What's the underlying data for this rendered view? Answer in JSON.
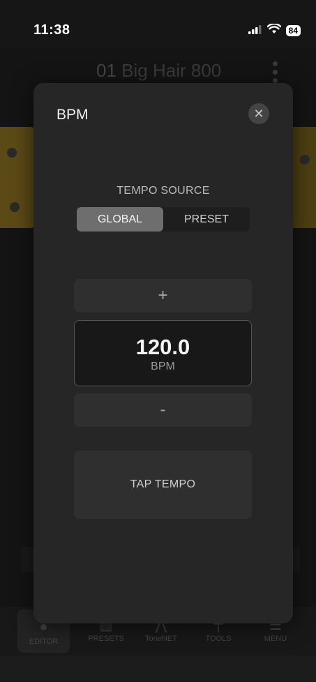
{
  "status_bar": {
    "time": "11:38",
    "battery": "84"
  },
  "background": {
    "preset_number": "01",
    "preset_name": "Big Hair 800"
  },
  "nav": [
    {
      "label": "EDITOR",
      "icon": "editor-icon",
      "active": true
    },
    {
      "label": "PRESETS",
      "icon": "presets-icon",
      "active": false
    },
    {
      "label": "ToneNET",
      "icon": "tonenet-icon",
      "active": false
    },
    {
      "label": "TOOLS",
      "icon": "tools-icon",
      "active": false
    },
    {
      "label": "MENU",
      "icon": "menu-icon",
      "active": false
    }
  ],
  "modal": {
    "title": "BPM",
    "close_icon": "close-icon",
    "tempo_source_label": "TEMPO SOURCE",
    "segments": [
      {
        "label": "GLOBAL",
        "selected": true
      },
      {
        "label": "PRESET",
        "selected": false
      }
    ],
    "increment_label": "+",
    "bpm_value": "120.0",
    "bpm_unit": "BPM",
    "decrement_label": "-",
    "tap_tempo_label": "TAP TEMPO"
  },
  "colors": {
    "modal_bg": "#262626",
    "segment_active": "#6e6e6e",
    "button_bg": "#2f2f2f",
    "display_bg": "#181818"
  }
}
